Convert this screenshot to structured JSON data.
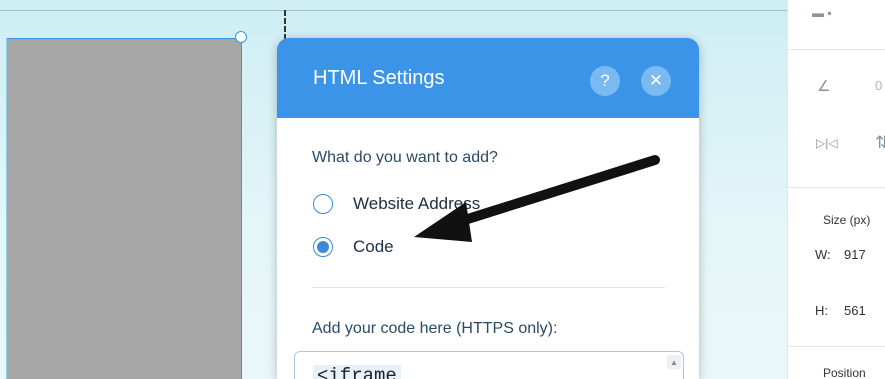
{
  "dialog": {
    "title": "HTML Settings",
    "help_icon": "?",
    "close_icon": "✕",
    "question": "What do you want to add?",
    "options": [
      {
        "label": "Website Address",
        "selected": false
      },
      {
        "label": "Code",
        "selected": true
      }
    ],
    "code_prompt": "Add your code here (HTTPS only):",
    "code_value": "<iframe"
  },
  "right_panel": {
    "angle_value": "0",
    "size_label": "Size (px)",
    "width_label": "W:",
    "width_value": "917",
    "height_label": "H:",
    "height_value": "561",
    "position_label": "Position"
  },
  "colors": {
    "header": "#3b94e8",
    "accent": "#3b8ad9",
    "canvas": "#cdeef4",
    "element": "#a7a7a7"
  },
  "icons": [
    "help-icon",
    "close-icon",
    "angle-icon",
    "flip-horizontal-icon",
    "flip-vertical-icon",
    "arrow-annotation-icon",
    "scroll-up-icon"
  ]
}
